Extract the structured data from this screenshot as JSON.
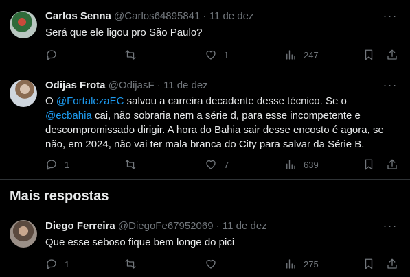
{
  "replies": [
    {
      "name": "Carlos Senna",
      "handle": "@Carlos64895841",
      "separator": "·",
      "date": "11 de dez",
      "text": "Será que ele ligou pro São Paulo?",
      "replies_count": "",
      "retweets_count": "",
      "likes_count": "1",
      "views_count": "247"
    },
    {
      "name": "Odijas Frota",
      "handle": "@OdijasF",
      "separator": "·",
      "date": "11 de dez",
      "text_parts": {
        "p1": "O ",
        "m1": "@FortalezaEC",
        "p2": "  salvou a carreira decadente desse técnico. Se o ",
        "m2": "@ecbahia",
        "p3": " cai, não sobraria nem a série d, para esse incompetente e descompromissado dirigir. A hora do Bahia sair desse encosto é agora, se não, em 2024, não vai ter mala branca do City para salvar da Série B."
      },
      "replies_count": "1",
      "retweets_count": "",
      "likes_count": "7",
      "views_count": "639"
    }
  ],
  "section_title": "Mais respostas",
  "more_replies": [
    {
      "name": "Diego Ferreira",
      "handle": "@DiegoFe67952069",
      "separator": "·",
      "date": "11 de dez",
      "text": "Que esse seboso fique bem longe do pici",
      "replies_count": "1",
      "retweets_count": "",
      "likes_count": "",
      "views_count": "275"
    }
  ],
  "colors": {
    "background": "#000000",
    "text": "#e7e9ea",
    "muted": "#71767b",
    "link": "#1d9bf0",
    "divider": "#2f3336"
  }
}
